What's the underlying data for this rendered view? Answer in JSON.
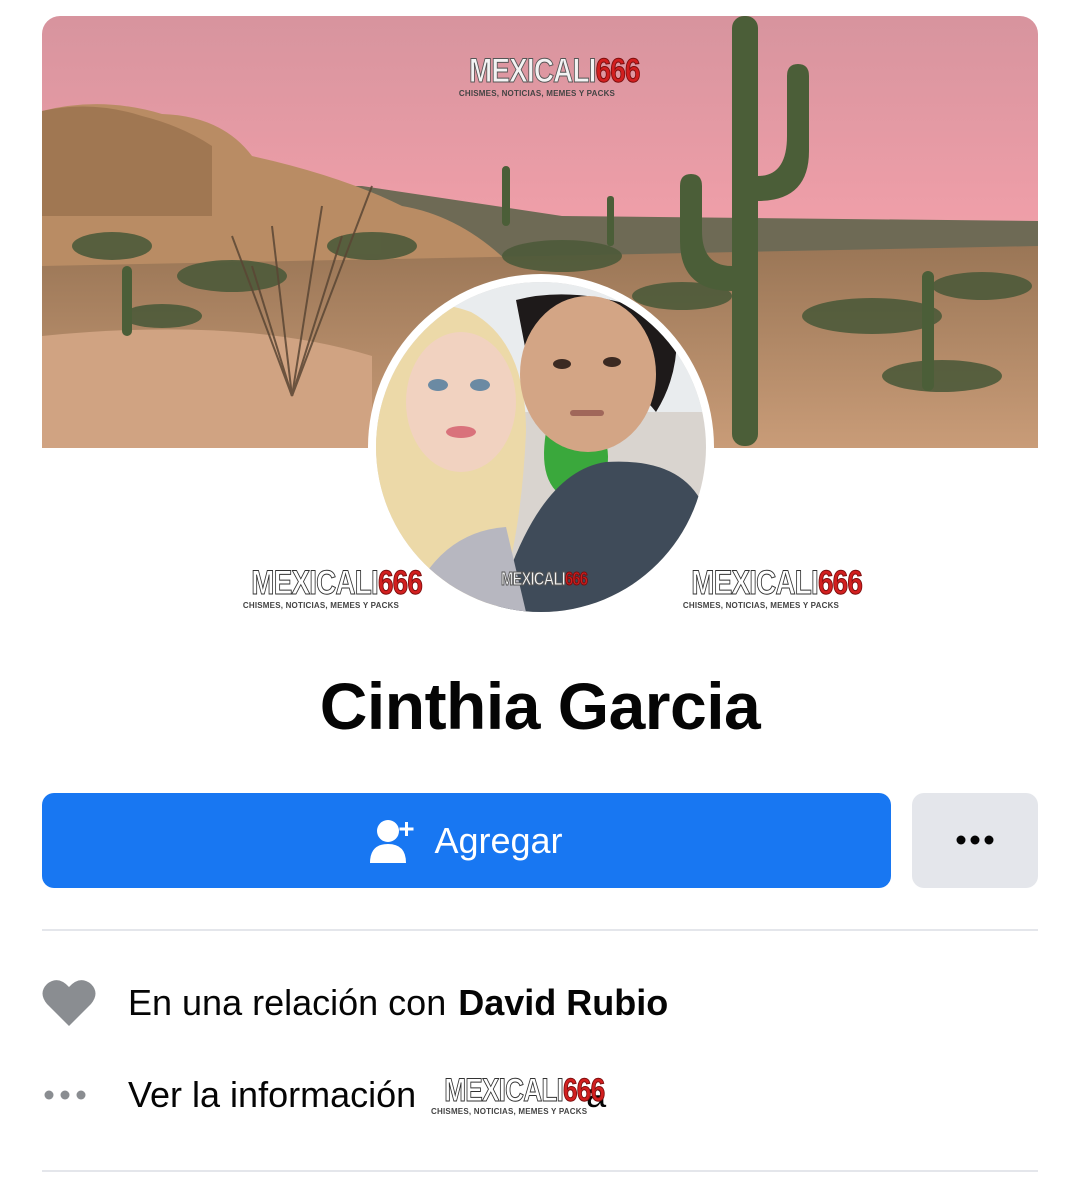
{
  "watermark": {
    "brand_part1": "MEXICALI",
    "brand_part2": "666",
    "tagline": "CHISMES, NOTICIAS, MEMES Y PACKS"
  },
  "profile": {
    "name": "Cinthia Garcia"
  },
  "actions": {
    "add_label": "Agregar",
    "add_icon": "add-friend-icon",
    "more_icon": "more-dots-icon"
  },
  "info": {
    "relationship_prefix": "En una relación con",
    "relationship_partner": "David Rubio",
    "relationship_icon": "heart-icon",
    "see_info_label": "Ver la información",
    "see_info_tail": "a",
    "see_info_icon": "more-dots-icon"
  },
  "colors": {
    "primary": "#1877f2",
    "secondary_button": "#e4e6eb",
    "icon_gray": "#8a8d91",
    "watermark_red": "#d21f1f"
  }
}
